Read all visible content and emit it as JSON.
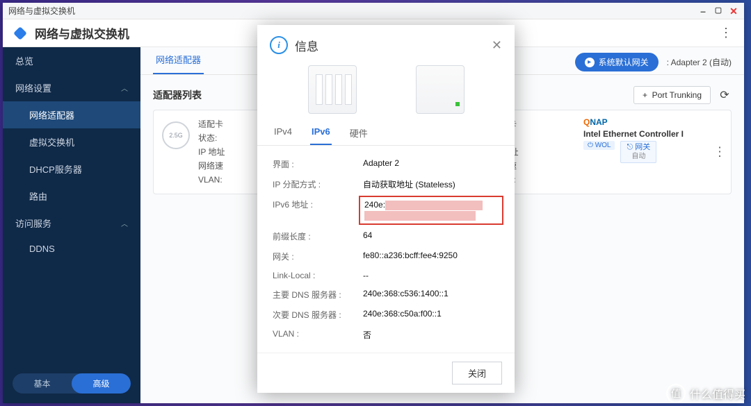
{
  "window": {
    "title": "网络与虚拟交换机"
  },
  "appbar": {
    "title": "网络与虚拟交换机"
  },
  "sidebar": {
    "overview": "总览",
    "network_settings": "网络设置",
    "items": [
      "网络适配器",
      "虚拟交换机",
      "DHCP服务器",
      "路由"
    ],
    "access_services": "访问服务",
    "ddns": "DDNS",
    "basic": "基本",
    "advanced": "高级"
  },
  "main": {
    "tab_adapter": "网络适配器",
    "btn_gateway": "系统默认网关",
    "gateway_value": "Adapter 2 (自动)",
    "list_header": "适配器列表",
    "port_trunking": "Port Trunking",
    "add_symbol": "+",
    "nic_badge": "2.5G",
    "card_keys": {
      "adapter": "适配卡",
      "state": "状态:",
      "ip": "IP 地址",
      "speed": "网络速",
      "vlan": "VLAN:"
    },
    "qnap": "QNAP",
    "ctrl_name": "Intel Ethernet Controller I",
    "wol": "⏻ WOL",
    "gw_tag": "网关",
    "gw_sub": "自动"
  },
  "modal": {
    "title": "信息",
    "tabs": {
      "ipv4": "IPv4",
      "ipv6": "IPv6",
      "hw": "硬件"
    },
    "kv": {
      "iface_k": "界面 :",
      "iface_v": "Adapter 2",
      "alloc_k": "IP 分配方式 :",
      "alloc_v": "自动获取地址 (Stateless)",
      "addr_k": "IPv6 地址 :",
      "addr_v": "240e:",
      "prefix_k": "前缀长度 :",
      "prefix_v": "64",
      "gw_k": "网关 :",
      "gw_v": "fe80::a236:bcff:fee4:9250",
      "ll_k": "Link-Local :",
      "ll_v": "--",
      "dns1_k": "主要 DNS 服务器 :",
      "dns1_v": "240e:368:c536:1400::1",
      "dns2_k": "次要 DNS 服务器 :",
      "dns2_v": "240e:368:c50a:f00::1",
      "vlan_k": "VLAN :",
      "vlan_v": "否"
    },
    "close": "关闭"
  },
  "watermark": {
    "char": "值",
    "text": "什么值得买"
  }
}
